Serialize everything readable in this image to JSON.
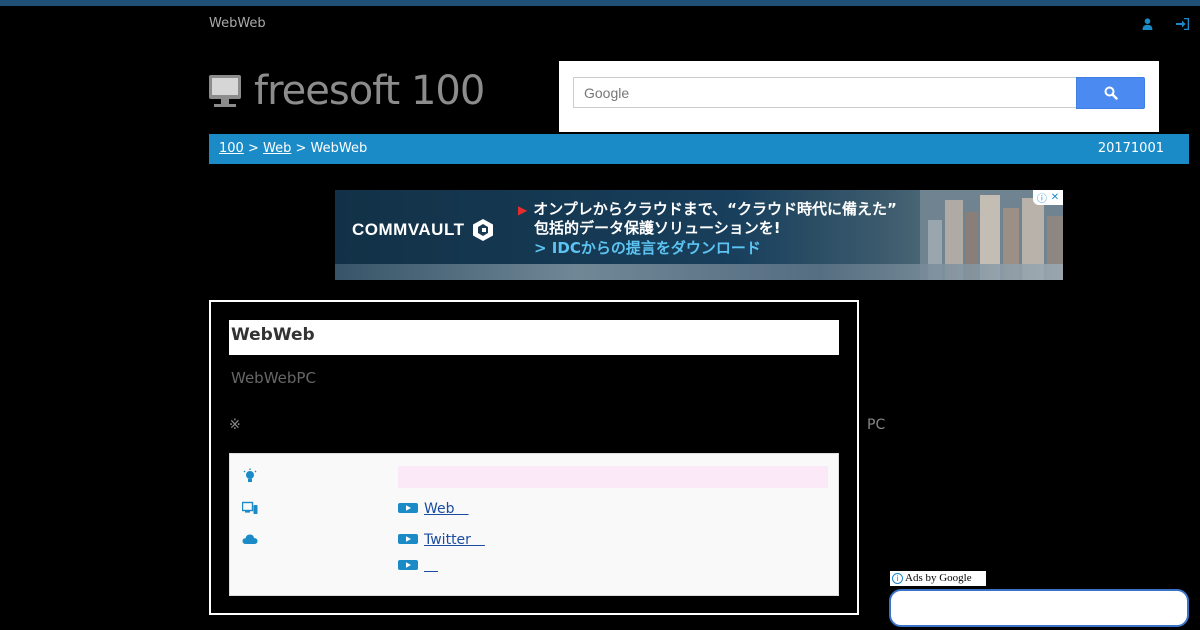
{
  "header": {
    "site_name": "WebWeb",
    "logo_text": "freesoft 100"
  },
  "search": {
    "placeholder": "Google"
  },
  "breadcrumb": {
    "items": [
      "100",
      "Web"
    ],
    "current": "WebWeb",
    "separator": ">",
    "date": "20171001"
  },
  "ad": {
    "brand": "COMMVAULT",
    "line1": "オンプレからクラウドまで、“クラウド時代に備えた”",
    "line2": "包括的データ保護ソリューションを!",
    "line3": "> IDCからの提言をダウンロード",
    "choices_icon": "ⓘ",
    "choices_close": "✕"
  },
  "card": {
    "title": "WebWeb",
    "subtitle": "WebWebPC",
    "note_mark": "※",
    "note_pc": "PC",
    "links": [
      {
        "label": "Web",
        "suffix": "　"
      },
      {
        "label": "Twitter",
        "suffix": "　"
      },
      {
        "label": "",
        "suffix": "　"
      }
    ],
    "icons": [
      "lightbulb-icon",
      "devices-icon",
      "cloud-icon"
    ]
  },
  "side_ad": {
    "label": "Ads by Google",
    "info_glyph": "i"
  },
  "colors": {
    "accent": "#1b8bc8",
    "search_button": "#4b8af0",
    "highlight": "#fbe9f7",
    "link": "#1a4ca1"
  }
}
